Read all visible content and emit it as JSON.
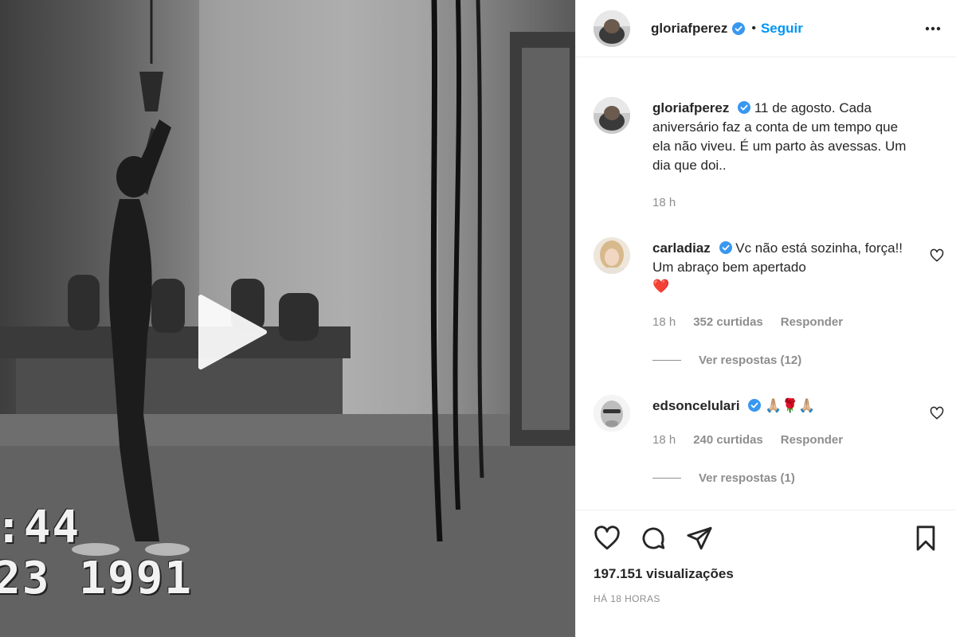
{
  "post": {
    "author": "gloriafperez",
    "follow_label": "Seguir",
    "dot": "•",
    "more_icon": "more-horizontal-icon",
    "caption": "11 de agosto. Cada aniversário faz a conta de um tempo que ela não viveu. É um parto às avessas. Um dia que doi..",
    "caption_time": "18 h"
  },
  "video": {
    "overlay_time": ":44",
    "overlay_date": "23  1991",
    "play_icon": "play-icon"
  },
  "comments": [
    {
      "username": "carladiaz",
      "text": "Vc não está sozinha, força!! Um abraço bem apertado",
      "emoji": "❤️",
      "time": "18 h",
      "likes": "352 curtidas",
      "reply_label": "Responder",
      "view_replies": "Ver respostas (12)"
    },
    {
      "username": "edsoncelulari",
      "text": "",
      "emoji": "🙏🏼🌹🙏🏼",
      "time": "18 h",
      "likes": "240 curtidas",
      "reply_label": "Responder",
      "view_replies": "Ver respostas (1)"
    }
  ],
  "footer": {
    "views": "197.151 visualizações",
    "posted": "HÁ 18 HORAS"
  },
  "colors": {
    "accent": "#0095f6",
    "text": "#262626",
    "muted": "#8e8e8e",
    "border": "#efefef",
    "heart_red": "#ed4956"
  }
}
